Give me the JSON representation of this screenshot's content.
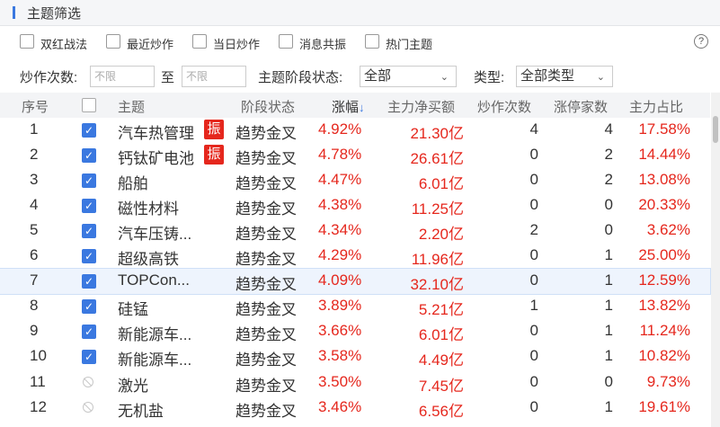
{
  "panel": {
    "title": "主题筛选"
  },
  "filters": {
    "checkboxes": [
      "双红战法",
      "最近炒作",
      "当日炒作",
      "消息共振",
      "热门主题"
    ],
    "hype_count_label": "炒作次数:",
    "from_placeholder": "不限",
    "to_label": "至",
    "to_placeholder": "不限",
    "stage_label": "主题阶段状态:",
    "stage_value": "全部",
    "type_label": "类型:",
    "type_value": "全部类型"
  },
  "help": "?",
  "table": {
    "headers": {
      "index": "序号",
      "theme": "主题",
      "stage": "阶段状态",
      "change": "涨幅",
      "change_arrow": "↓",
      "net_buy": "主力净买额",
      "hype": "炒作次数",
      "limit_up": "涨停家数",
      "ratio": "主力占比"
    },
    "rows": [
      {
        "index": "1",
        "checked": true,
        "theme": "汽车热管理",
        "badge": "振",
        "stage": "趋势金叉",
        "change": "4.92%",
        "net_buy": "21.30亿",
        "hype": "4",
        "limit_up": "4",
        "ratio": "17.58%"
      },
      {
        "index": "2",
        "checked": true,
        "theme": "钙钛矿电池",
        "badge": "振",
        "stage": "趋势金叉",
        "change": "4.78%",
        "net_buy": "26.61亿",
        "hype": "0",
        "limit_up": "2",
        "ratio": "14.44%"
      },
      {
        "index": "3",
        "checked": true,
        "theme": "船舶",
        "stage": "趋势金叉",
        "change": "4.47%",
        "net_buy": "6.01亿",
        "hype": "0",
        "limit_up": "2",
        "ratio": "13.08%"
      },
      {
        "index": "4",
        "checked": true,
        "theme": "磁性材料",
        "stage": "趋势金叉",
        "change": "4.38%",
        "net_buy": "11.25亿",
        "hype": "0",
        "limit_up": "0",
        "ratio": "20.33%"
      },
      {
        "index": "5",
        "checked": true,
        "theme": "汽车压铸...",
        "stage": "趋势金叉",
        "change": "4.34%",
        "net_buy": "2.20亿",
        "hype": "2",
        "limit_up": "0",
        "ratio": "3.62%"
      },
      {
        "index": "6",
        "checked": true,
        "theme": "超级高铁",
        "stage": "趋势金叉",
        "change": "4.29%",
        "net_buy": "11.96亿",
        "hype": "0",
        "limit_up": "1",
        "ratio": "25.00%"
      },
      {
        "index": "7",
        "checked": true,
        "theme": "TOPCon...",
        "stage": "趋势金叉",
        "change": "4.09%",
        "net_buy": "32.10亿",
        "hype": "0",
        "limit_up": "1",
        "ratio": "12.59%"
      },
      {
        "index": "8",
        "checked": true,
        "theme": "硅锰",
        "stage": "趋势金叉",
        "change": "3.89%",
        "net_buy": "5.21亿",
        "hype": "1",
        "limit_up": "1",
        "ratio": "13.82%"
      },
      {
        "index": "9",
        "checked": true,
        "theme": "新能源车...",
        "stage": "趋势金叉",
        "change": "3.66%",
        "net_buy": "6.01亿",
        "hype": "0",
        "limit_up": "1",
        "ratio": "11.24%"
      },
      {
        "index": "10",
        "checked": true,
        "theme": "新能源车...",
        "stage": "趋势金叉",
        "change": "3.58%",
        "net_buy": "4.49亿",
        "hype": "0",
        "limit_up": "1",
        "ratio": "10.82%"
      },
      {
        "index": "11",
        "checked": false,
        "theme": "激光",
        "stage": "趋势金叉",
        "change": "3.50%",
        "net_buy": "7.45亿",
        "hype": "0",
        "limit_up": "0",
        "ratio": "9.73%"
      },
      {
        "index": "12",
        "checked": false,
        "theme": "无机盐",
        "stage": "趋势金叉",
        "change": "3.46%",
        "net_buy": "6.56亿",
        "hype": "0",
        "limit_up": "1",
        "ratio": "19.61%"
      }
    ]
  },
  "colors": {
    "accent": "#3a78e0",
    "rise": "#e5271d"
  }
}
